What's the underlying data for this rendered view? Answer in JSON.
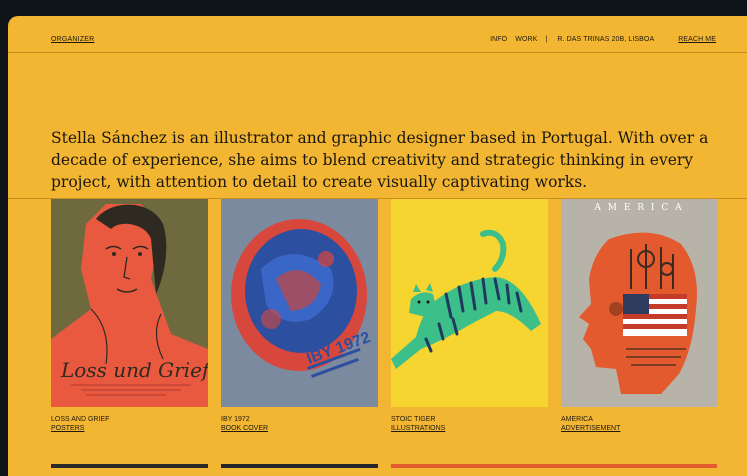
{
  "nav": {
    "brand": "ORGANIZER",
    "info": "INFO",
    "work": "WORK",
    "separator": "|",
    "address": "R. DAS TRINAS 20B, LISBOA",
    "contact": "REACH ME"
  },
  "intro": {
    "text": "Stella Sánchez is an illustrator and graphic designer based in Portugal. With over a decade of experience, she aims to blend creativity and strategic thinking in every project, with attention to detail to create visually captivating works."
  },
  "works": [
    {
      "title": "LOSS AND GRIEF",
      "category": "POSTERS",
      "art_text": "Loss und Grief"
    },
    {
      "title": "IBY 1972",
      "category": "BOOK COVER",
      "art_text": "IBY 1972"
    },
    {
      "title": "STOIC TIGER",
      "category": "ILLUSTRATIONS"
    },
    {
      "title": "AMERICA",
      "category": "ADVERTISEMENT",
      "art_text": "A M E R I C A"
    }
  ],
  "colors": {
    "background": "#f2b632",
    "page": "#0f1418",
    "text": "#1b1710"
  }
}
